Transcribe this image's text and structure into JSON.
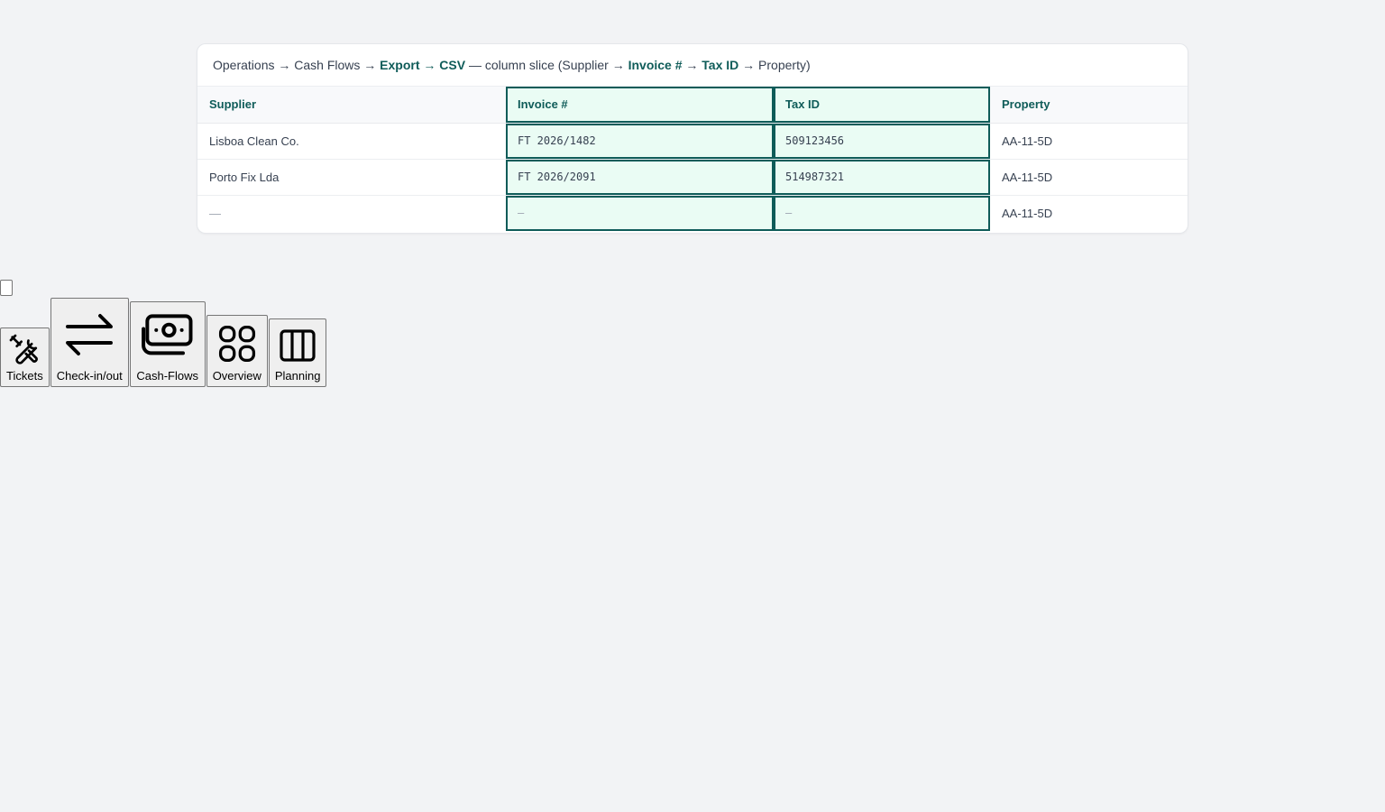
{
  "breadcrumb": {
    "part1": "Operations → Cash Flows → ",
    "part2": "Export → CSV",
    "part3": " — column slice (Supplier → ",
    "part4": "Invoice #",
    "part5": " → ",
    "part6": "Tax ID",
    "part7": " → Property)"
  },
  "table": {
    "headers": [
      "Supplier",
      "Invoice #",
      "Tax ID",
      "Property"
    ],
    "rows": [
      [
        "Lisboa Clean Co.",
        "FT 2026/1482",
        "509123456",
        "AA-11-5D"
      ],
      [
        "Porto Fix Lda",
        "FT 2026/2091",
        "514987321",
        "AA-11-5D"
      ],
      [
        "—",
        "—",
        "—",
        "AA-11-5D"
      ]
    ]
  },
  "dock": {
    "items": [
      {
        "label": "Tickets",
        "icon": "tools-icon"
      },
      {
        "label": "Check-in/out",
        "icon": "arrows-exchange-icon"
      },
      {
        "label": "Cash-Flows",
        "icon": "cash-icon"
      },
      {
        "label": "Overview",
        "icon": "grid-icon"
      },
      {
        "label": "Planning",
        "icon": "columns-icon"
      }
    ]
  },
  "colors": {
    "accent": "#0f5c59",
    "selected_bg": "#eafcf4",
    "page_bg": "#f2f3f5"
  }
}
